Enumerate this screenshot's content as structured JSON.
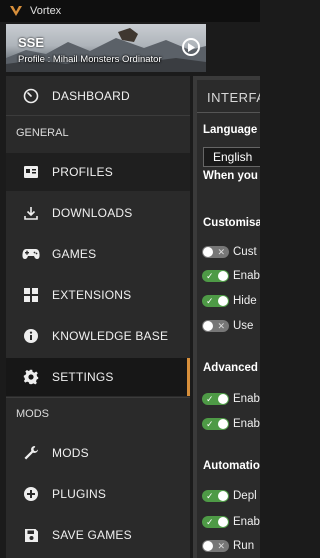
{
  "window": {
    "title": "Vortex"
  },
  "banner": {
    "game": "SSE",
    "profile": "Profile : Mihail Monsters Ordinator"
  },
  "sidebar": {
    "dashboard": "DASHBOARD",
    "section_general": "GENERAL",
    "general_items": [
      "PROFILES",
      "DOWNLOADS",
      "GAMES",
      "EXTENSIONS",
      "KNOWLEDGE BASE",
      "SETTINGS"
    ],
    "section_mods": "MODS",
    "mods_items": [
      "MODS",
      "PLUGINS",
      "SAVE GAMES"
    ]
  },
  "settings": {
    "tab_title": "INTERFAC",
    "language_label": "Language",
    "language_value": "English",
    "language_note": "When you",
    "customisation_heading": "Customisa",
    "customisation_toggles": [
      {
        "label": "Cust",
        "on": false
      },
      {
        "label": "Enab",
        "on": true
      },
      {
        "label": "Hide",
        "on": true
      },
      {
        "label": "Use",
        "on": false
      }
    ],
    "advanced_heading": "Advanced",
    "advanced_toggles": [
      {
        "label": "Enab",
        "on": true
      },
      {
        "label": "Enab",
        "on": true
      }
    ],
    "automation_heading": "Automatio",
    "automation_toggles": [
      {
        "label": "Depl",
        "on": true
      },
      {
        "label": "Enab",
        "on": true
      },
      {
        "label": "Run",
        "on": false
      }
    ]
  },
  "colors": {
    "accent": "#d78f3b",
    "toggle_on": "#4e9a46",
    "toggle_off": "#777777"
  }
}
